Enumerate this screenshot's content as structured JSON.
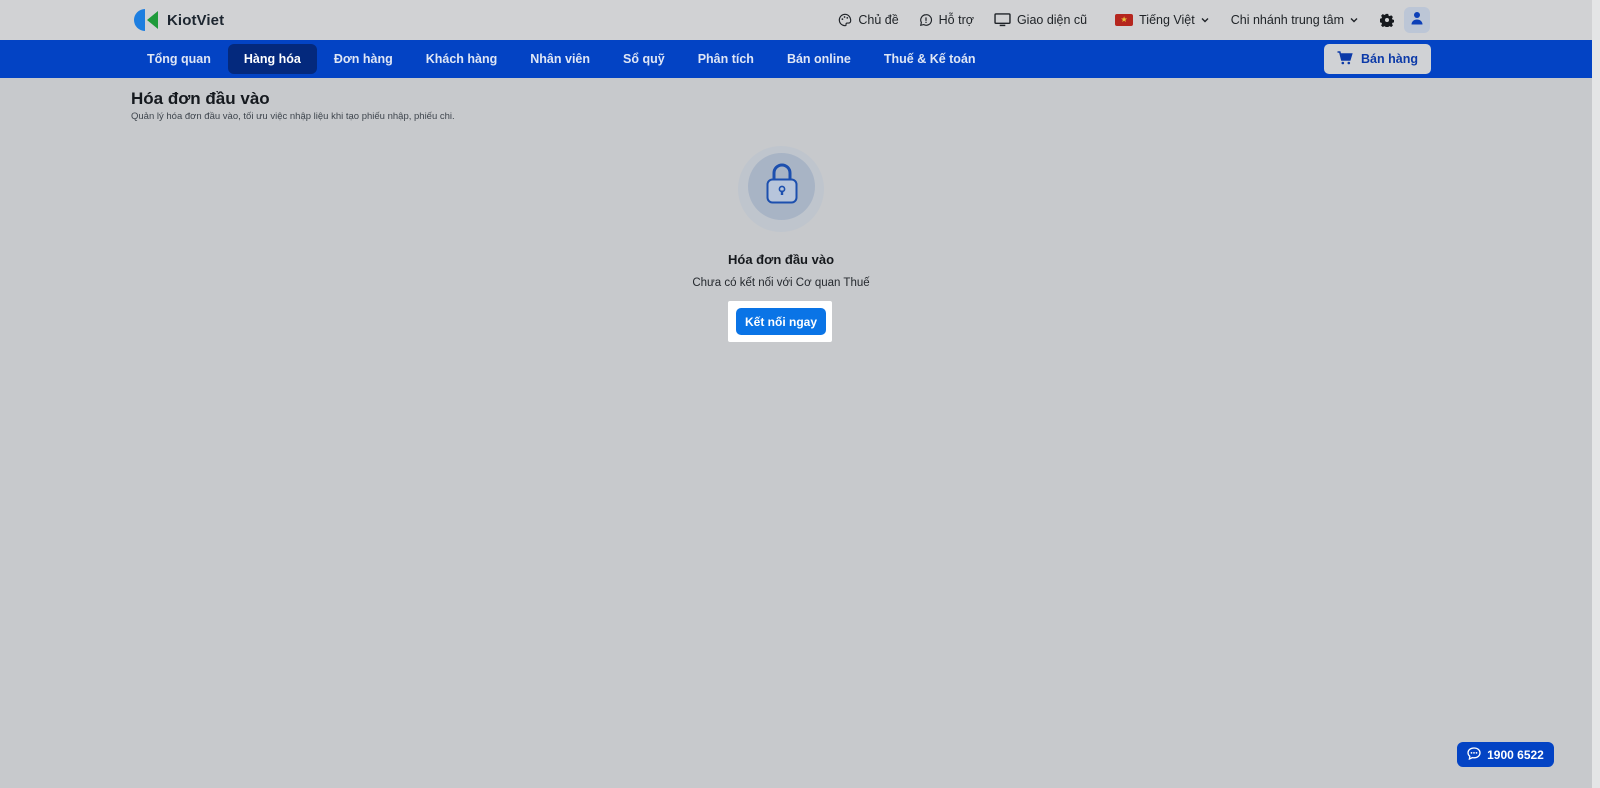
{
  "brand": {
    "name": "KiotViet"
  },
  "topbar": {
    "theme_label": "Chủ đề",
    "support_label": "Hỗ trợ",
    "old_ui_label": "Giao diện cũ",
    "language_label": "Tiếng Việt",
    "branch_label": "Chi nhánh trung tâm",
    "icons": {
      "theme": "palette-icon",
      "support": "chat-icon",
      "old_ui": "monitor-icon",
      "language": "vietnam-flag-icon",
      "settings": "gear-icon",
      "account": "user-icon"
    }
  },
  "nav": {
    "items": [
      {
        "label": "Tổng quan"
      },
      {
        "label": "Hàng hóa",
        "active": true
      },
      {
        "label": "Đơn hàng"
      },
      {
        "label": "Khách hàng"
      },
      {
        "label": "Nhân viên"
      },
      {
        "label": "Sổ quỹ"
      },
      {
        "label": "Phân tích"
      },
      {
        "label": "Bán online"
      },
      {
        "label": "Thuế & Kế toán"
      }
    ],
    "sell_label": "Bán hàng"
  },
  "page": {
    "title": "Hóa đơn đầu vào",
    "subtitle": "Quản lý hóa đơn đầu vào, tối ưu việc nhập liệu khi tạo phiếu nhập, phiếu chi."
  },
  "empty_state": {
    "icon": "lock-icon",
    "title": "Hóa đơn đầu vào",
    "description": "Chưa có kết nối với Cơ quan Thuế",
    "button_label": "Kết nối ngay"
  },
  "hotline": {
    "number": "1900 6522"
  },
  "colors": {
    "nav_bg": "#0343c4",
    "nav_active_bg": "#04297d",
    "primary_button": "#0a74e6",
    "page_bg": "#c7c9cc"
  }
}
